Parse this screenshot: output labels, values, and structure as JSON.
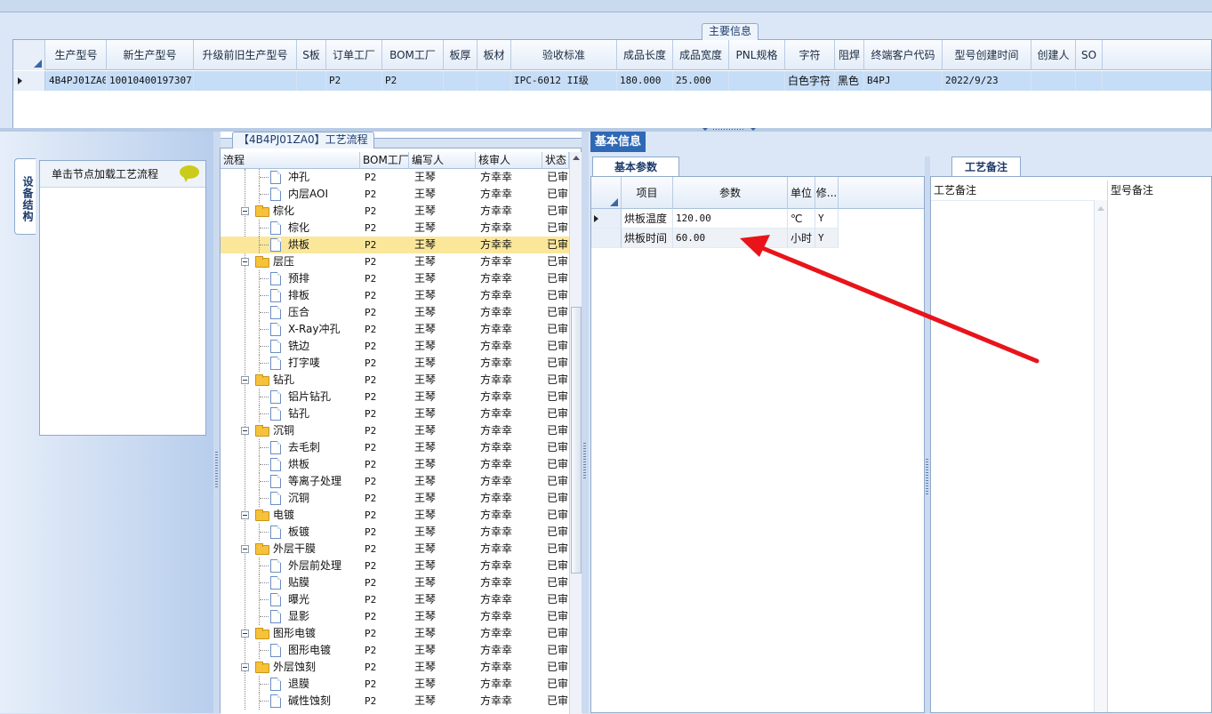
{
  "main_panel": {
    "tab_label": "主要信息",
    "columns": [
      "生产型号",
      "新生产型号",
      "升级前旧生产型号",
      "S板",
      "订单工厂",
      "BOM工厂",
      "板厚",
      "板材",
      "验收标准",
      "成品长度",
      "成品宽度",
      "PNL规格",
      "字符",
      "阻焊",
      "终端客户代码",
      "型号创建时间",
      "创建人",
      "SO"
    ],
    "row": [
      "4B4PJ01ZA0",
      "10010400197307",
      "",
      "",
      "P2",
      "P2",
      "",
      "",
      "IPC-6012 II级",
      "180.000",
      "25.000",
      "",
      "白色字符",
      "黑色",
      "B4PJ",
      "2022/9/23",
      "",
      ""
    ]
  },
  "left_panel": {
    "vertical_tab": "设备结构",
    "card_text": "单击节点加载工艺流程",
    "bubble_icon": "speech-bubble-icon"
  },
  "process_panel": {
    "tab_label": "【4B4PJ01ZA0】工艺流程",
    "columns": [
      "流程",
      "BOM工厂",
      "编写人",
      "核审人",
      "状态"
    ],
    "selected_index": 4,
    "rows": [
      {
        "level": 2,
        "type": "doc",
        "name": "冲孔",
        "bom": "P2",
        "writer": "王琴",
        "reviewer": "方幸幸",
        "status": "已审"
      },
      {
        "level": 2,
        "type": "doc",
        "name": "内层AOI",
        "bom": "P2",
        "writer": "王琴",
        "reviewer": "方幸幸",
        "status": "已审"
      },
      {
        "level": 1,
        "type": "folder",
        "name": "棕化",
        "bom": "P2",
        "writer": "王琴",
        "reviewer": "方幸幸",
        "status": "已审"
      },
      {
        "level": 2,
        "type": "doc",
        "name": "棕化",
        "bom": "P2",
        "writer": "王琴",
        "reviewer": "方幸幸",
        "status": "已审"
      },
      {
        "level": 2,
        "type": "doc",
        "name": "烘板",
        "bom": "P2",
        "writer": "王琴",
        "reviewer": "方幸幸",
        "status": "已审"
      },
      {
        "level": 1,
        "type": "folder",
        "name": "层压",
        "bom": "P2",
        "writer": "王琴",
        "reviewer": "方幸幸",
        "status": "已审"
      },
      {
        "level": 2,
        "type": "doc",
        "name": "预排",
        "bom": "P2",
        "writer": "王琴",
        "reviewer": "方幸幸",
        "status": "已审"
      },
      {
        "level": 2,
        "type": "doc",
        "name": "排板",
        "bom": "P2",
        "writer": "王琴",
        "reviewer": "方幸幸",
        "status": "已审"
      },
      {
        "level": 2,
        "type": "doc",
        "name": "压合",
        "bom": "P2",
        "writer": "王琴",
        "reviewer": "方幸幸",
        "status": "已审"
      },
      {
        "level": 2,
        "type": "doc",
        "name": "X-Ray冲孔",
        "bom": "P2",
        "writer": "王琴",
        "reviewer": "方幸幸",
        "status": "已审"
      },
      {
        "level": 2,
        "type": "doc",
        "name": "铣边",
        "bom": "P2",
        "writer": "王琴",
        "reviewer": "方幸幸",
        "status": "已审"
      },
      {
        "level": 2,
        "type": "doc",
        "name": "打字唛",
        "bom": "P2",
        "writer": "王琴",
        "reviewer": "方幸幸",
        "status": "已审"
      },
      {
        "level": 1,
        "type": "folder",
        "name": "钻孔",
        "bom": "P2",
        "writer": "王琴",
        "reviewer": "方幸幸",
        "status": "已审"
      },
      {
        "level": 2,
        "type": "doc",
        "name": "铝片钻孔",
        "bom": "P2",
        "writer": "王琴",
        "reviewer": "方幸幸",
        "status": "已审"
      },
      {
        "level": 2,
        "type": "doc",
        "name": "钻孔",
        "bom": "P2",
        "writer": "王琴",
        "reviewer": "方幸幸",
        "status": "已审"
      },
      {
        "level": 1,
        "type": "folder",
        "name": "沉铜",
        "bom": "P2",
        "writer": "王琴",
        "reviewer": "方幸幸",
        "status": "已审"
      },
      {
        "level": 2,
        "type": "doc",
        "name": "去毛刺",
        "bom": "P2",
        "writer": "王琴",
        "reviewer": "方幸幸",
        "status": "已审"
      },
      {
        "level": 2,
        "type": "doc",
        "name": "烘板",
        "bom": "P2",
        "writer": "王琴",
        "reviewer": "方幸幸",
        "status": "已审"
      },
      {
        "level": 2,
        "type": "doc",
        "name": "等离子处理",
        "bom": "P2",
        "writer": "王琴",
        "reviewer": "方幸幸",
        "status": "已审"
      },
      {
        "level": 2,
        "type": "doc",
        "name": "沉铜",
        "bom": "P2",
        "writer": "王琴",
        "reviewer": "方幸幸",
        "status": "已审"
      },
      {
        "level": 1,
        "type": "folder",
        "name": "电镀",
        "bom": "P2",
        "writer": "王琴",
        "reviewer": "方幸幸",
        "status": "已审"
      },
      {
        "level": 2,
        "type": "doc",
        "name": "板镀",
        "bom": "P2",
        "writer": "王琴",
        "reviewer": "方幸幸",
        "status": "已审"
      },
      {
        "level": 1,
        "type": "folder",
        "name": "外层干膜",
        "bom": "P2",
        "writer": "王琴",
        "reviewer": "方幸幸",
        "status": "已审"
      },
      {
        "level": 2,
        "type": "doc",
        "name": "外层前处理",
        "bom": "P2",
        "writer": "王琴",
        "reviewer": "方幸幸",
        "status": "已审"
      },
      {
        "level": 2,
        "type": "doc",
        "name": "贴膜",
        "bom": "P2",
        "writer": "王琴",
        "reviewer": "方幸幸",
        "status": "已审"
      },
      {
        "level": 2,
        "type": "doc",
        "name": "曝光",
        "bom": "P2",
        "writer": "王琴",
        "reviewer": "方幸幸",
        "status": "已审"
      },
      {
        "level": 2,
        "type": "doc",
        "name": "显影",
        "bom": "P2",
        "writer": "王琴",
        "reviewer": "方幸幸",
        "status": "已审"
      },
      {
        "level": 1,
        "type": "folder",
        "name": "图形电镀",
        "bom": "P2",
        "writer": "王琴",
        "reviewer": "方幸幸",
        "status": "已审"
      },
      {
        "level": 2,
        "type": "doc",
        "name": "图形电镀",
        "bom": "P2",
        "writer": "王琴",
        "reviewer": "方幸幸",
        "status": "已审"
      },
      {
        "level": 1,
        "type": "folder",
        "name": "外层蚀刻",
        "bom": "P2",
        "writer": "王琴",
        "reviewer": "方幸幸",
        "status": "已审"
      },
      {
        "level": 2,
        "type": "doc",
        "name": "退膜",
        "bom": "P2",
        "writer": "王琴",
        "reviewer": "方幸幸",
        "status": "已审"
      },
      {
        "level": 2,
        "type": "doc",
        "name": "碱性蚀刻",
        "bom": "P2",
        "writer": "王琴",
        "reviewer": "方幸幸",
        "status": "已审"
      }
    ]
  },
  "basic_info": {
    "tab_label": "基本信息",
    "sub_tab": "基本参数",
    "columns": [
      "项目",
      "参数",
      "单位",
      "修..."
    ],
    "rows": [
      {
        "item": "烘板温度",
        "value": "120.00",
        "unit": "℃",
        "mod": "Y"
      },
      {
        "item": "烘板时间",
        "value": "60.00",
        "unit": "小时",
        "mod": "Y"
      }
    ]
  },
  "notes": {
    "tab_label": "工艺备注",
    "col1": "工艺备注",
    "col2": "型号备注"
  },
  "colors": {
    "accent": "#2f68b4",
    "selection": "#fbe79a",
    "row_highlight": "#c6ddf7",
    "annotation_arrow": "#e8141a"
  }
}
